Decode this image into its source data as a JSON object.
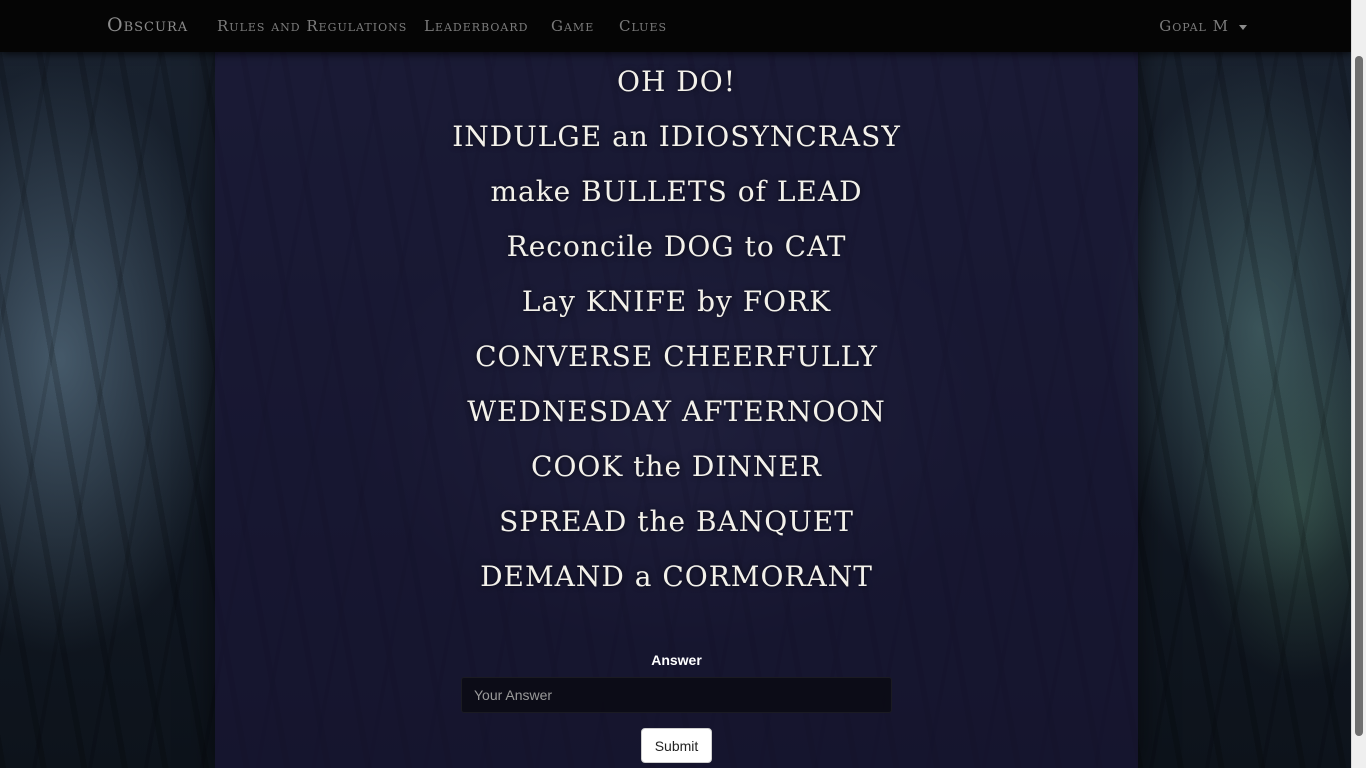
{
  "navbar": {
    "brand": "Obscura",
    "links": [
      "Rules and Regulations",
      "Leaderboard",
      "Game",
      "Clues"
    ],
    "user": "Gopal M"
  },
  "clues": [
    "OH DO!",
    "INDULGE an IDIOSYNCRASY",
    "make BULLETS of LEAD",
    "Reconcile DOG to CAT",
    "Lay KNIFE by FORK",
    "CONVERSE CHEERFULLY",
    "WEDNESDAY AFTERNOON",
    "COOK the DINNER",
    "SPREAD the BANQUET",
    "DEMAND a CORMORANT"
  ],
  "form": {
    "label": "Answer",
    "placeholder": "Your Answer",
    "value": "",
    "submit_label": "Submit"
  }
}
